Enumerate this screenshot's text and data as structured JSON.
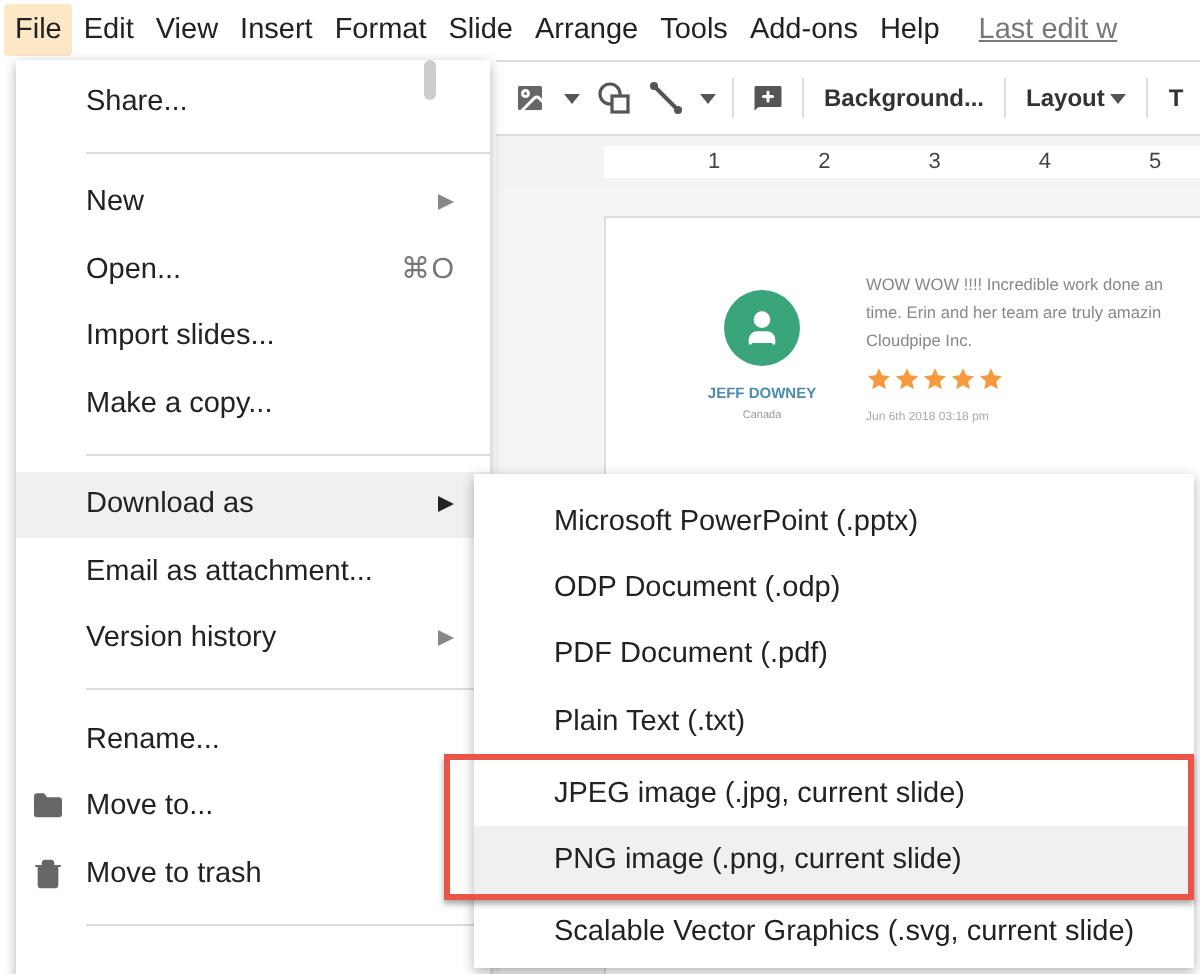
{
  "menubar": {
    "items": [
      {
        "label": "File",
        "selected": true
      },
      {
        "label": "Edit",
        "selected": false
      },
      {
        "label": "View",
        "selected": false
      },
      {
        "label": "Insert",
        "selected": false
      },
      {
        "label": "Format",
        "selected": false
      },
      {
        "label": "Slide",
        "selected": false
      },
      {
        "label": "Arrange",
        "selected": false
      },
      {
        "label": "Tools",
        "selected": false
      },
      {
        "label": "Add-ons",
        "selected": false
      },
      {
        "label": "Help",
        "selected": false
      }
    ],
    "last_edit": "Last edit w"
  },
  "toolbar": {
    "buttons": [
      {
        "label": "Background...",
        "dropdown": false
      },
      {
        "label": "Layout",
        "dropdown": true
      },
      {
        "label": "T",
        "dropdown": false
      }
    ]
  },
  "ruler": {
    "marks": [
      "1",
      "2",
      "3",
      "4",
      "5"
    ]
  },
  "review": {
    "name": "JEFF DOWNEY",
    "location": "Canada",
    "lines": [
      "WOW WOW !!!! Incredible work done an",
      "time. Erin and her team are truly amazin",
      "Cloudpipe Inc."
    ],
    "stars": 5,
    "date": "Jun 6th 2018 03:18 pm"
  },
  "file_menu": {
    "items": [
      {
        "kind": "item",
        "label": "Share...",
        "submenu": false,
        "highlighted": false
      },
      {
        "kind": "separator"
      },
      {
        "kind": "item",
        "label": "New",
        "submenu": true,
        "highlighted": false
      },
      {
        "kind": "item",
        "label": "Open...",
        "shortcut": "⌘O",
        "submenu": false,
        "highlighted": false
      },
      {
        "kind": "item",
        "label": "Import slides...",
        "submenu": false,
        "highlighted": false
      },
      {
        "kind": "item",
        "label": "Make a copy...",
        "submenu": false,
        "highlighted": false
      },
      {
        "kind": "separator"
      },
      {
        "kind": "item",
        "label": "Download as",
        "submenu": true,
        "highlighted": true
      },
      {
        "kind": "item",
        "label": "Email as attachment...",
        "submenu": false,
        "highlighted": false
      },
      {
        "kind": "item",
        "label": "Version history",
        "submenu": true,
        "highlighted": false
      },
      {
        "kind": "separator"
      },
      {
        "kind": "item",
        "label": "Rename...",
        "submenu": false,
        "highlighted": false
      },
      {
        "kind": "folder_item",
        "label": "Move to...",
        "submenu": false,
        "highlighted": false
      },
      {
        "kind": "trash_item",
        "label": "Move to trash",
        "submenu": false,
        "highlighted": false
      },
      {
        "kind": "separator"
      }
    ]
  },
  "download_menu": {
    "items": [
      {
        "label": "Microsoft PowerPoint (.pptx)",
        "selected": false,
        "outlined": false
      },
      {
        "label": "ODP Document (.odp)",
        "selected": false,
        "outlined": false
      },
      {
        "label": "PDF Document (.pdf)",
        "selected": false,
        "outlined": false
      },
      {
        "label": "Plain Text (.txt)",
        "selected": false,
        "outlined": false
      },
      {
        "label": "JPEG image (.jpg, current slide)",
        "selected": false,
        "outlined": true
      },
      {
        "label": "PNG image (.png, current slide)",
        "selected": true,
        "outlined": true
      },
      {
        "label": "Scalable Vector Graphics (.svg, current slide)",
        "selected": false,
        "outlined": false
      }
    ]
  }
}
